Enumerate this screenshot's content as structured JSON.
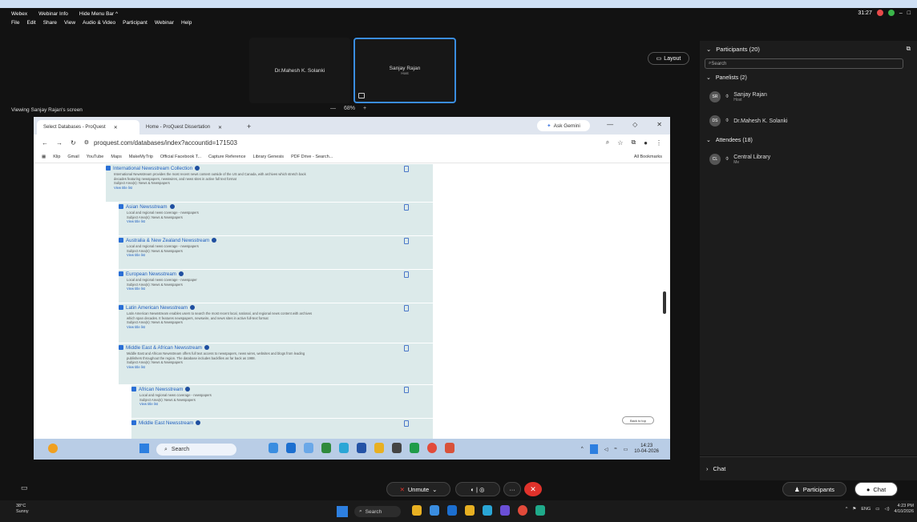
{
  "menubar": {
    "app": "Webex",
    "webinar_info": "Webinar Info",
    "hide_menu": "Hide Menu Bar ^",
    "menus": [
      "File",
      "Edit",
      "Share",
      "View",
      "Audio & Video",
      "Participant",
      "Webinar",
      "Help"
    ],
    "clock": "31:27"
  },
  "tiles": [
    {
      "name": "Dr.Mahesh K. Solanki",
      "sub": ""
    },
    {
      "name": "Sanjay Rajan",
      "sub": "Host"
    }
  ],
  "layout_label": "Layout",
  "viewing": "Viewing Sanjay Rajan's screen",
  "zoom": {
    "minus": "—",
    "value": "68%",
    "plus": "+"
  },
  "browser": {
    "tabs": [
      {
        "title": "Select Databases - ProQuest"
      },
      {
        "title": "Home - ProQuest Dissertation"
      }
    ],
    "gemini": "Ask Gemini",
    "url": "proquest.com/databases/index?accountid=171503",
    "bookmarks": [
      "Klip",
      "Gmail",
      "YouTube",
      "Maps",
      "MakeMyTrip",
      "Official Facebook T...",
      "Capture Reference",
      "Library Genesis",
      "PDF Drive - Search..."
    ],
    "all_bookmarks": "All Bookmarks",
    "back_to_top": "Back to top",
    "items": [
      {
        "title": "International Newsstream Collection",
        "desc": [
          "International Newsstream provides the most recent news content outside of the US and Canada, with archives which stretch back",
          "decades featuring newspapers, newswires, and news sites in active full text format"
        ],
        "subject": "Subject Area(s): News & Newspapers",
        "link": "View title list"
      },
      {
        "title": "Asian Newsstream",
        "desc": [
          "Local and regional news coverage - newspapers"
        ],
        "subject": "Subject Area(s): News & Newspapers",
        "link": "View title list"
      },
      {
        "title": "Australia & New Zealand Newsstream",
        "desc": [
          "Local and regional news coverage - newspapers"
        ],
        "subject": "Subject Area(s): News & Newspapers",
        "link": "View title list"
      },
      {
        "title": "European Newsstream",
        "desc": [
          "Local and regional news coverage - newspaper"
        ],
        "subject": "Subject Area(s): News & Newspapers",
        "link": "View title list"
      },
      {
        "title": "Latin American Newsstream",
        "desc": [
          "Latin American Newsstream enables users to search the most recent local, national, and regional news content with archives",
          "which span decades. It features newspapers, newswire, and news sites in active full-text format"
        ],
        "subject": "Subject Area(s): News & Newspapers",
        "link": "View title list"
      },
      {
        "title": "Middle East & African Newsstream",
        "desc": [
          "Middle East and African Newsstream offers full text access to newspapers, news wires, websites and blogs from leading",
          "publishers throughout the region. The database includes backfiles as far back as 1988."
        ],
        "subject": "Subject Area(s): News & Newspapers",
        "link": "View title list"
      },
      {
        "title": "African Newsstream",
        "desc": [
          "Local and regional news coverage - newspapers"
        ],
        "subject": "Subject Area(s): News & Newspapers",
        "link": "View title list"
      },
      {
        "title": "Middle East Newsstream",
        "desc": [],
        "subject": "",
        "link": ""
      }
    ],
    "taskbar": {
      "search": "Search",
      "time": "14:23",
      "date": "10-04-2026"
    }
  },
  "panel": {
    "title": "Participants (20)",
    "search": "Search",
    "panelists": "Panelists (2)",
    "attendees": "Attendees (18)",
    "people": [
      {
        "initials": "SR",
        "name": "Sanjay Rajan",
        "sub": "Host"
      },
      {
        "initials": "DS",
        "name": "Dr.Mahesh K. Solanki",
        "sub": ""
      },
      {
        "initials": "CL",
        "name": "Central Library",
        "sub": "Me"
      }
    ],
    "chat": "Chat"
  },
  "controls": {
    "unmute": "Unmute",
    "participants": "Participants",
    "chat": "Chat"
  },
  "win": {
    "temp": "38°C",
    "weather": "Sunny",
    "search": "Search",
    "lang": "ENG",
    "time": "4:23 PM",
    "date": "4/10/2026"
  }
}
